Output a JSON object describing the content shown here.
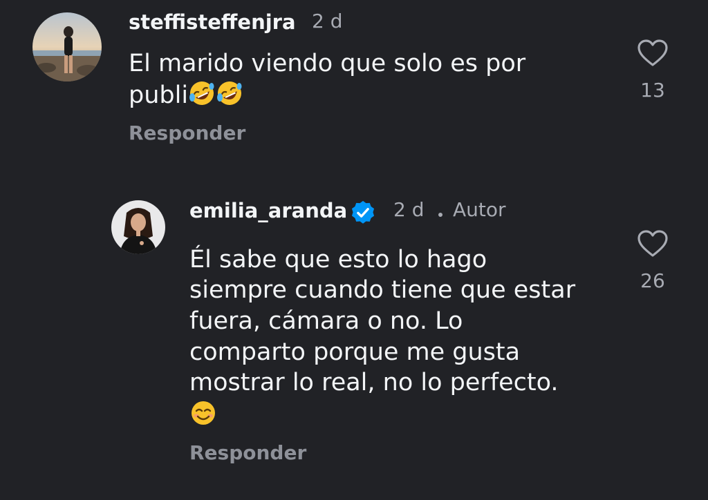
{
  "comments": [
    {
      "username": "steffisteffenjra",
      "time": "2 d",
      "lines": [
        "El marido viendo que solo es por",
        "publi"
      ],
      "trailing_emoji": "rolling-on-floor-laughing",
      "reply_label": "Responder",
      "likes": "13"
    },
    {
      "username": "emilia_aranda",
      "verified": true,
      "time": "2 d",
      "author_tag": "Autor",
      "lines": [
        "Él sabe que esto lo hago",
        "siempre cuando tiene que estar",
        "fuera, cámara o no. Lo",
        "comparto porque me gusta",
        "mostrar lo real, no lo perfecto."
      ],
      "trailing_emoji": "smiling-face",
      "reply_label": "Responder",
      "likes": "26"
    }
  ],
  "colors": {
    "background": "#212226",
    "primary_text": "#f3f5f7",
    "secondary_text": "#a8abb3",
    "reply_text": "#8e9199",
    "verified_blue": "#0095f6"
  },
  "icons": {
    "like": "heart-outline-icon",
    "verified": "verified-badge-icon"
  }
}
